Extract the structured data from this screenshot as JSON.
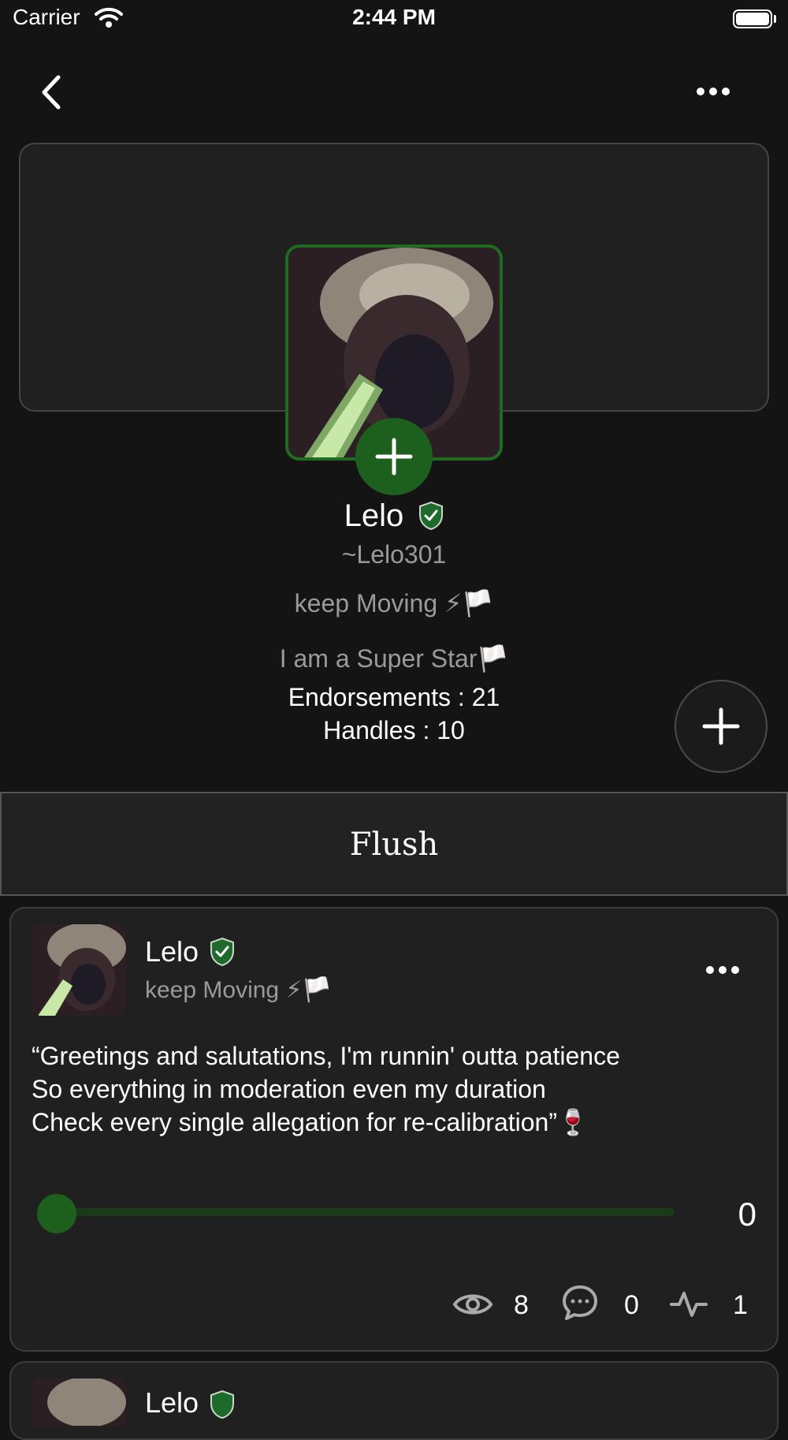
{
  "status_bar": {
    "carrier": "Carrier",
    "time": "2:44 PM"
  },
  "nav": {
    "back_icon": "chevron-left-icon",
    "more_icon": "ellipsis-icon"
  },
  "profile": {
    "name": "Lelo",
    "handle": "~Lelo301",
    "tagline": "keep Moving ⚡🏳️",
    "bio": "I am a Super Star🏳️",
    "endorsements": "Endorsements : 21",
    "handles": "Handles : 10",
    "verified_icon": "verified-shield-icon",
    "accent_color": "#1d5f1d"
  },
  "tab": {
    "label": "Flush"
  },
  "post": {
    "author": "Lelo",
    "tagline": "keep Moving ⚡🏳️",
    "text": "“Greetings and salutations, I'm runnin' outta patience\nSo everything in moderation even my duration\nCheck every single allegation for re-calibration”🍷",
    "slider_value": "0",
    "views": "8",
    "comments": "0",
    "activity": "1"
  },
  "next_post": {
    "author": "Lelo"
  }
}
